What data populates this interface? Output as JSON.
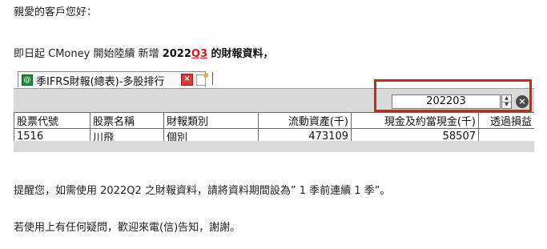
{
  "greeting": "親愛的客戶您好：",
  "intro": {
    "prefix": "即日起 CMoney 開始陸續 新增 ",
    "year": "2022",
    "quarter": "Q3",
    "suffix": " 的財報資料，"
  },
  "window": {
    "tab_label": "季IFRS財報(總表)-多股排行",
    "period_value": "202203"
  },
  "table": {
    "headers": [
      "股票代號",
      "股票名稱",
      "財報類別",
      "流動資產(千)",
      "現金及約當現金(千)",
      "透過損益"
    ],
    "rows": [
      [
        "1516",
        "川飛",
        "個別",
        "473109",
        "58507",
        ""
      ]
    ]
  },
  "reminder": "提醒您，如需使用 2022Q2 之財報資料，請將資料期間設為” 1 季前連續 1 季”。",
  "contact": "若使用上有任何疑問，歡迎來電(信)告知，謝謝。",
  "colors": {
    "highlight_border": "#e01b1b",
    "quarter_text": "#e0191b"
  }
}
